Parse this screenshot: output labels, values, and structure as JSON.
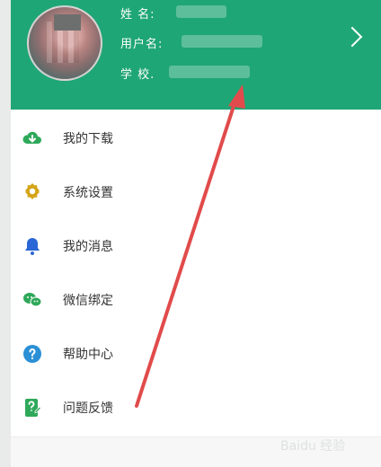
{
  "profile": {
    "name_label": "姓 名:",
    "username_label": "用户名:",
    "school_label": "学 校."
  },
  "menu": [
    {
      "label": "我的下载",
      "icon": "cloud-download-icon"
    },
    {
      "label": "系统设置",
      "icon": "gear-icon"
    },
    {
      "label": "我的消息",
      "icon": "bell-icon"
    },
    {
      "label": "微信绑定",
      "icon": "wechat-icon"
    },
    {
      "label": "帮助中心",
      "icon": "help-icon"
    },
    {
      "label": "问题反馈",
      "icon": "feedback-icon"
    }
  ],
  "colors": {
    "header_bg": "#1fa676",
    "arrow": "#e14b4b"
  },
  "watermark_text": "Baidu 经验"
}
